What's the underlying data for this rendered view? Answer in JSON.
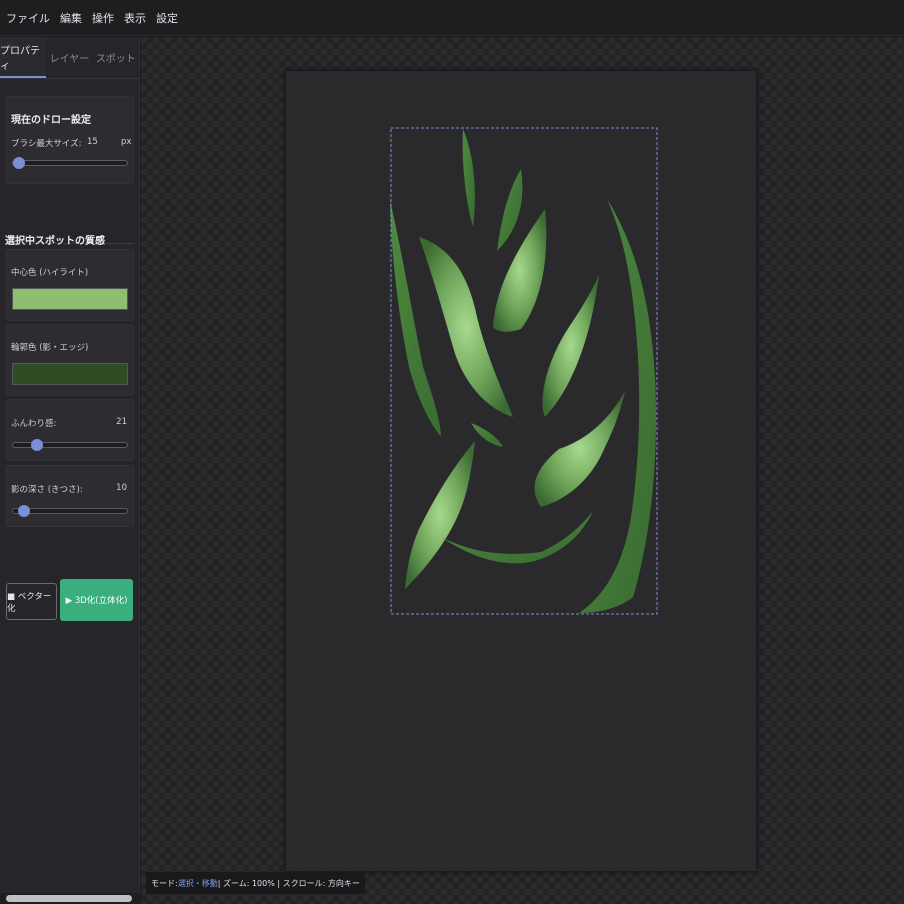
{
  "menu": [
    "ファイル",
    "編集",
    "操作",
    "表示",
    "設定"
  ],
  "tabs": [
    "プロパティ",
    "レイヤー",
    "スポット"
  ],
  "draw_settings": {
    "title": "現在のドロー設定",
    "brush_label": "ブラシ最大サイズ:",
    "brush_value": "15",
    "brush_unit": "px",
    "brush_fraction": 0.05
  },
  "spot": {
    "title": "選択中スポットの質感",
    "center_label": "中心色 (ハイライト)",
    "center_color": "#8dbf73",
    "edge_label": "輪郭色 (影・エッジ)",
    "edge_color": "#2e4d23",
    "softness_label": "ふんわり感:",
    "softness_value": "21",
    "softness_fraction": 0.21,
    "depth_label": "影の深さ (きつさ):",
    "depth_value": "10",
    "depth_fraction": 0.1
  },
  "buttons": {
    "vector": "■ ベクター化",
    "three_d": "▶ 3D化(立体化)"
  },
  "status": {
    "mode_prefix": "モード: ",
    "mode_value": "選択・移動",
    "rest": " | ズーム: 100% | スクロール: 方向キー"
  },
  "colors": {
    "accent": "#7b8fd8",
    "primary_button": "#3aae7c",
    "leaf_light": "#9fd288",
    "leaf_dark": "#3f6f34"
  }
}
